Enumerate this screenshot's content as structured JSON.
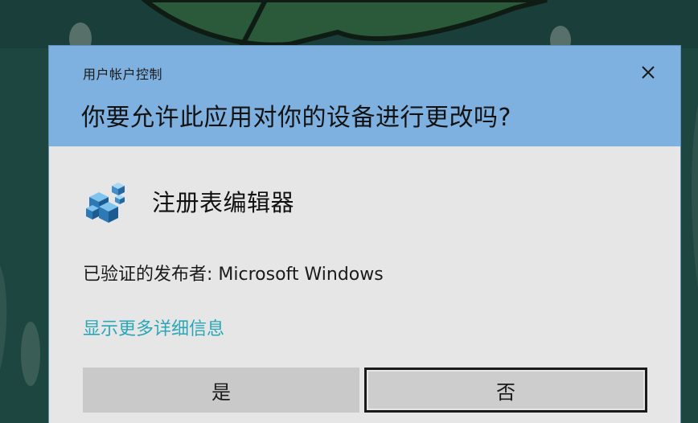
{
  "dialog": {
    "caption": "用户帐户控制",
    "question": "你要允许此应用对你的设备进行更改吗?",
    "close_icon": "close-icon"
  },
  "app": {
    "icon": "registry-editor-icon",
    "name": "注册表编辑器"
  },
  "publisher": {
    "text": "已验证的发布者: Microsoft Windows"
  },
  "details_link": {
    "label": "显示更多详细信息"
  },
  "buttons": {
    "yes_label": "是",
    "no_label": "否"
  },
  "colors": {
    "header": "#7eb1e0",
    "dialog_body": "#e6e6e6",
    "link": "#2aa7b7",
    "desktop": "#1f4a44"
  }
}
